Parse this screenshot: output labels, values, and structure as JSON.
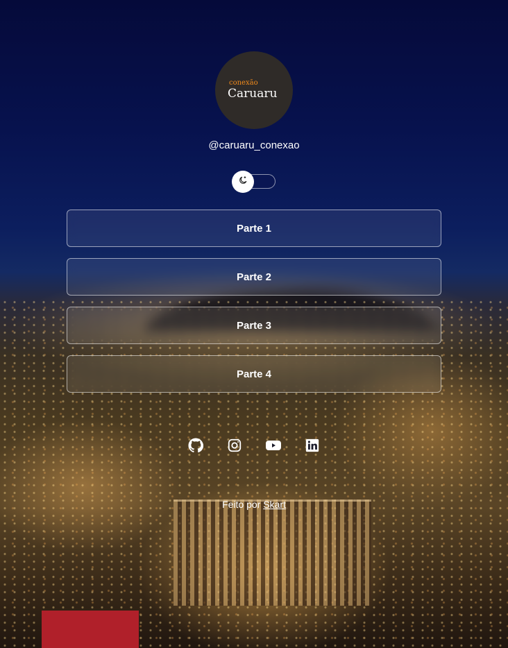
{
  "profile": {
    "logo_small": "conexão",
    "logo_big": "Caruaru",
    "handle": "@caruaru_conexao"
  },
  "theme_toggle": {
    "icon": "moon-icon",
    "mode": "dark"
  },
  "links": [
    {
      "label": "Parte 1"
    },
    {
      "label": "Parte 2"
    },
    {
      "label": "Parte 3"
    },
    {
      "label": "Parte 4"
    }
  ],
  "socials": [
    {
      "icon": "github-icon"
    },
    {
      "icon": "instagram-icon"
    },
    {
      "icon": "youtube-icon"
    },
    {
      "icon": "linkedin-icon"
    }
  ],
  "footer": {
    "prefix": "Feito por",
    "author": "Skart"
  },
  "colors": {
    "logo_accent": "#f08a1c",
    "avatar_bg": "#2f2b28",
    "text": "#ffffff"
  }
}
